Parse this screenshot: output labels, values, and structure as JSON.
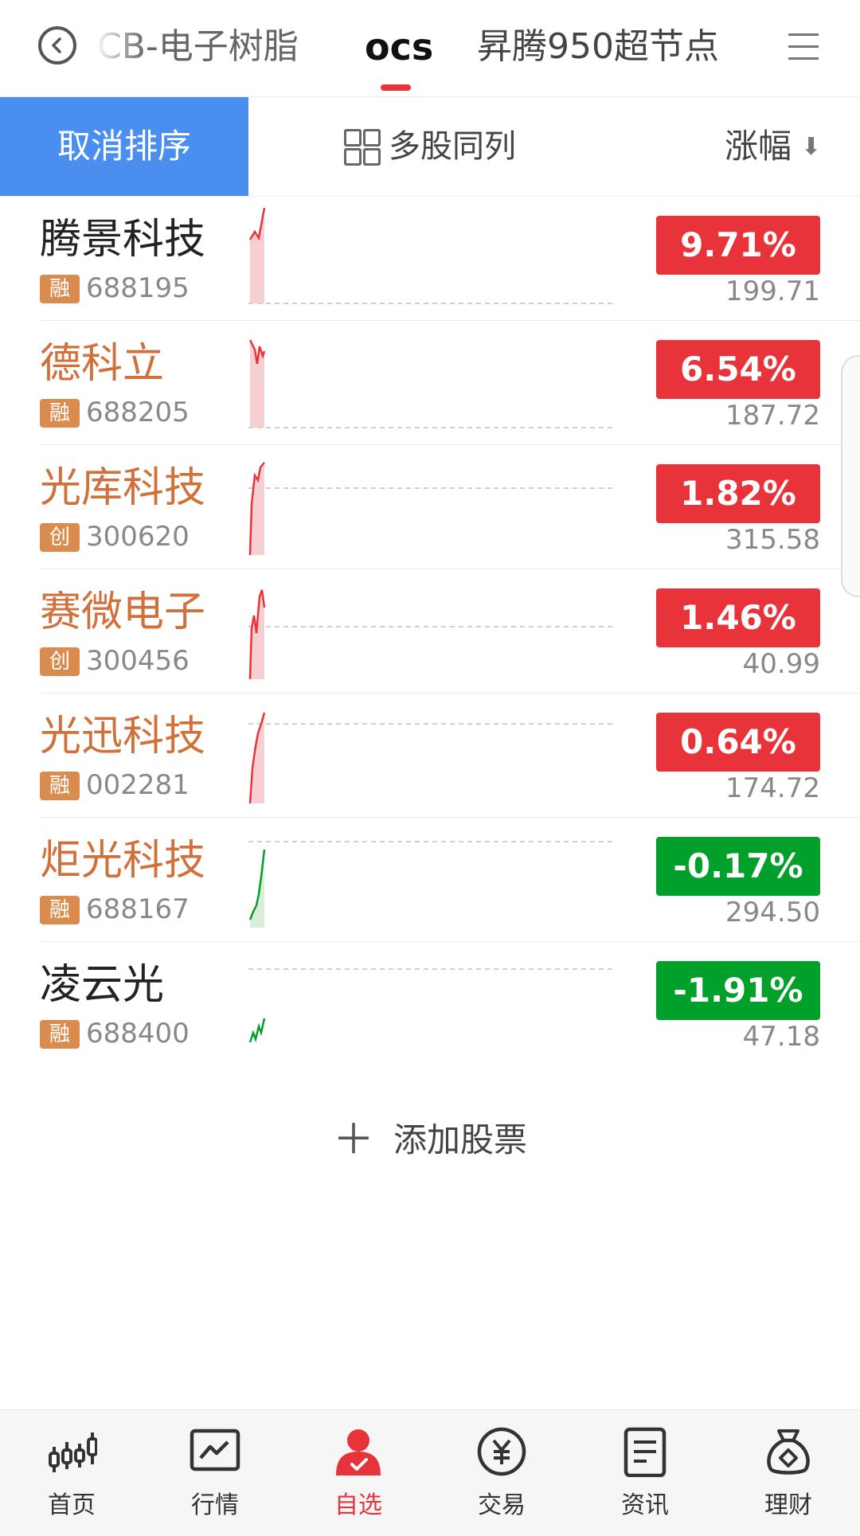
{
  "top_tabs": {
    "items": [
      "CB-电子树脂",
      "ocs",
      "昇腾950超节点"
    ],
    "active_index": 1
  },
  "sort_bar": {
    "cancel_label": "取消排序",
    "multi_column_label": "多股同列",
    "sort_field_label": "涨幅",
    "sort_direction": "desc"
  },
  "colors": {
    "up": "#e8333a",
    "down": "#00a02a",
    "accent_blue": "#4a8ff0",
    "name_orange": "#d0703a",
    "badge_orange": "#d98c4e"
  },
  "stocks": [
    {
      "name": "腾景科技",
      "name_color": "#222222",
      "badge": "融",
      "code": "688195",
      "change": "9.71%",
      "direction": "up",
      "price": "199.71"
    },
    {
      "name": "德科立",
      "name_color": "#d0703a",
      "badge": "融",
      "code": "688205",
      "change": "6.54%",
      "direction": "up",
      "price": "187.72"
    },
    {
      "name": "光库科技",
      "name_color": "#d0703a",
      "badge": "创",
      "code": "300620",
      "change": "1.82%",
      "direction": "up",
      "price": "315.58"
    },
    {
      "name": "赛微电子",
      "name_color": "#d0703a",
      "badge": "创",
      "code": "300456",
      "change": "1.46%",
      "direction": "up",
      "price": "40.99"
    },
    {
      "name": "光迅科技",
      "name_color": "#d0703a",
      "badge": "融",
      "code": "002281",
      "change": "0.64%",
      "direction": "up",
      "price": "174.72"
    },
    {
      "name": "炬光科技",
      "name_color": "#d0703a",
      "badge": "融",
      "code": "688167",
      "change": "-0.17%",
      "direction": "down",
      "price": "294.50"
    },
    {
      "name": "凌云光",
      "name_color": "#222222",
      "badge": "融",
      "code": "688400",
      "change": "-1.91%",
      "direction": "down",
      "price": "47.18"
    }
  ],
  "add_stock_label": "添加股票",
  "bottom_nav": {
    "items": [
      {
        "label": "首页",
        "icon": "candlestick-icon"
      },
      {
        "label": "行情",
        "icon": "line-chart-icon"
      },
      {
        "label": "自选",
        "icon": "person-check-icon"
      },
      {
        "label": "交易",
        "icon": "yuan-coin-icon"
      },
      {
        "label": "资讯",
        "icon": "document-icon"
      },
      {
        "label": "理财",
        "icon": "money-bag-icon"
      }
    ],
    "active_index": 2
  }
}
